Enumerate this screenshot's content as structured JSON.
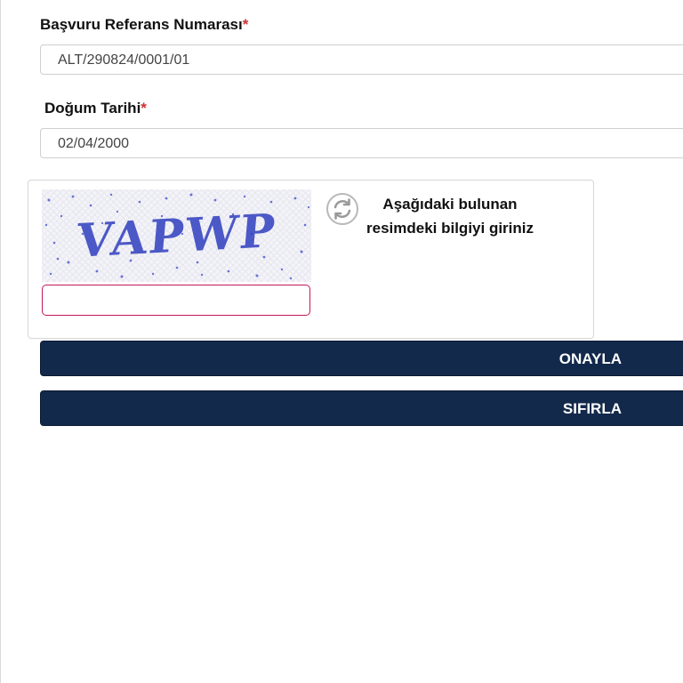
{
  "form": {
    "reference": {
      "label": "Başvuru Referans Numarası",
      "required_mark": "*",
      "value": "ALT/290824/0001/01"
    },
    "birth_date": {
      "label": "Doğum Tarihi",
      "required_mark": "*",
      "value": "02/04/2000"
    }
  },
  "captcha": {
    "image_text": "VAPWP",
    "instruction_line1": "Aşağıdaki bulunan",
    "instruction_line2": "resimdeki bilgiyi giriniz",
    "input_value": "",
    "refresh_icon": "refresh-icon"
  },
  "buttons": {
    "confirm_label": "ONAYLA",
    "reset_label": "SIFIRLA"
  },
  "colors": {
    "button_bg": "#13294b",
    "required": "#d32f2f",
    "captcha_input_border": "#c2185b",
    "captcha_text": "#2f3fbf"
  }
}
